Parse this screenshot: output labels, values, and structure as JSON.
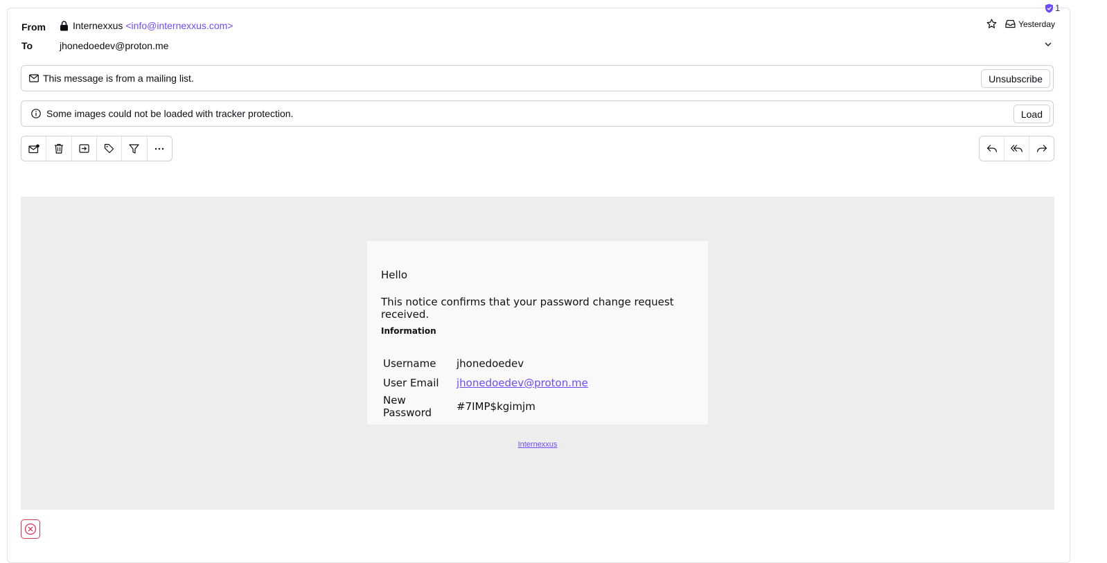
{
  "header": {
    "from_label": "From",
    "sender_name": "Internexxus",
    "sender_email": "<info@internexxus.com>",
    "to_label": "To",
    "recipient": "jhonedoedev@proton.me",
    "date": "Yesterday",
    "tracker_count": "1"
  },
  "banners": {
    "mailing_list_text": "This message is from a mailing list.",
    "unsubscribe_label": "Unsubscribe",
    "images_text": "Some images could not be loaded with tracker protection.",
    "load_label": "Load"
  },
  "toolbar": {
    "left_icons": [
      "mark-unread-icon",
      "trash-icon",
      "move-icon",
      "label-icon",
      "filter-icon",
      "more-icon"
    ],
    "right_icons": [
      "reply-icon",
      "reply-all-icon",
      "forward-icon"
    ]
  },
  "message": {
    "greeting": "Hello",
    "notice": "This notice confirms that your password change request received.",
    "info_heading": "Information",
    "rows": [
      {
        "key": "Username",
        "value": "jhonedoedev"
      },
      {
        "key": "User Email",
        "value": "jhonedoedev@proton.me"
      },
      {
        "key": "New Password",
        "value": "#7IMP$kgimjm"
      }
    ],
    "footer_link": "Internexxus"
  },
  "colors": {
    "accent": "#6d4aff",
    "danger": "#dc3251",
    "body_bg": "#ededed",
    "card_bg": "#f9f9f9"
  }
}
